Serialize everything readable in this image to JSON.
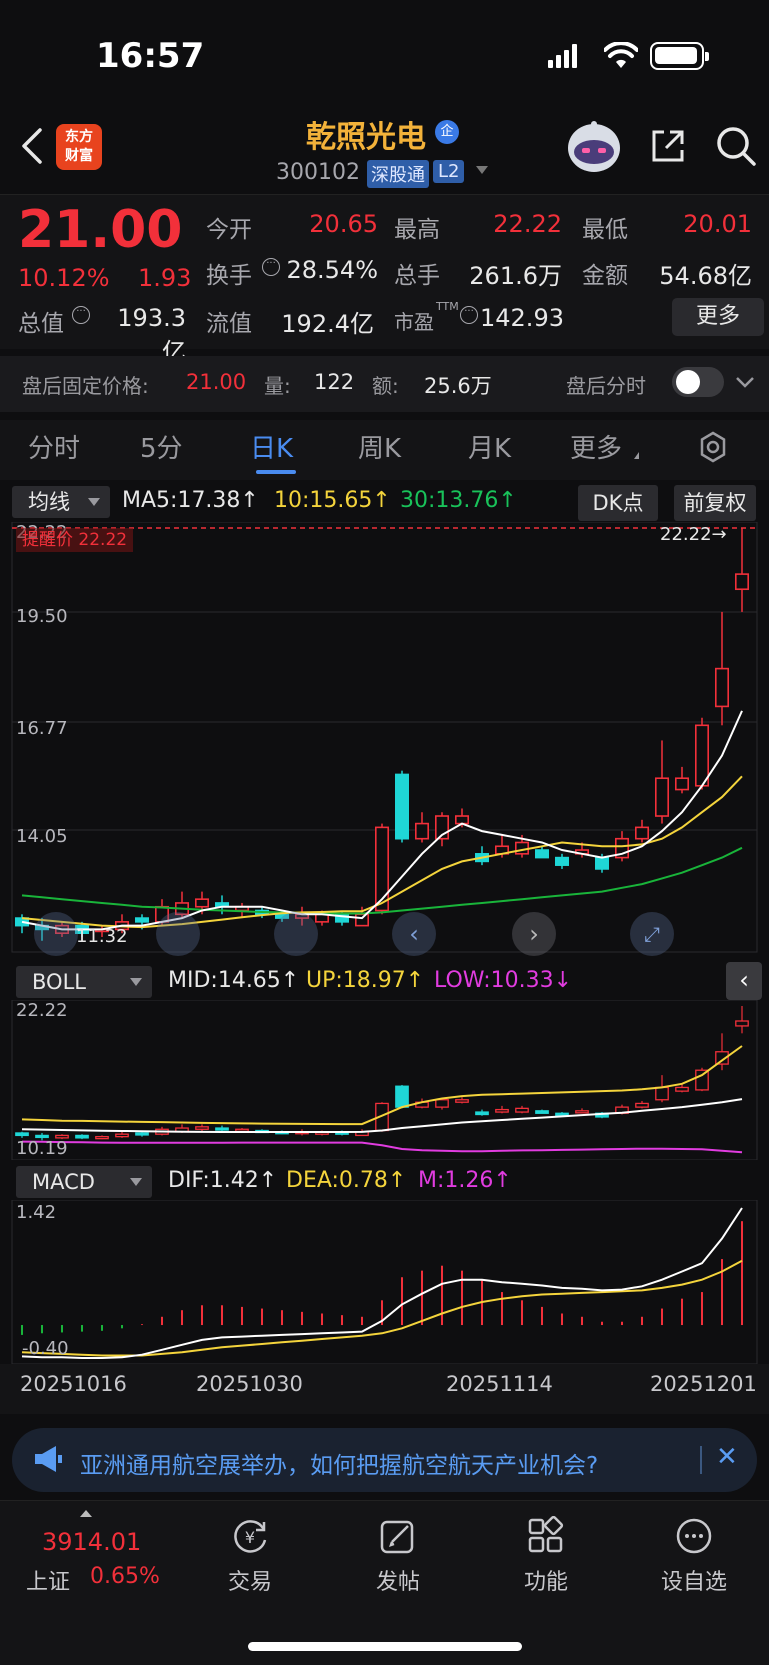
{
  "status": {
    "time": "16:57"
  },
  "header": {
    "logo_line1": "东方",
    "logo_line2": "财富",
    "stock_name": "乾照光电",
    "badge": "企",
    "code": "300102",
    "tag_sgt": "深股通",
    "tag_l2": "L2"
  },
  "quote": {
    "price": "21.00",
    "pct": "10.12%",
    "change": "1.93",
    "open_label": "今开",
    "open": "20.65",
    "high_label": "最高",
    "high": "22.22",
    "low_label": "最低",
    "low": "20.01",
    "turnover_label": "换手",
    "turnover": "28.54%",
    "volume_label": "总手",
    "volume": "261.6万",
    "amount_label": "金额",
    "amount": "54.68亿",
    "mcap_label": "总值",
    "mcap": "193.3亿",
    "float_label": "流值",
    "float": "192.4亿",
    "pe_label": "市盈",
    "pe_sup": "TTM",
    "pe": "142.93",
    "more": "更多"
  },
  "after_hours": {
    "label": "盘后固定价格:",
    "price": "21.00",
    "vol_label": "量:",
    "vol": "122",
    "amt_label": "额:",
    "amt": "25.6万",
    "toggle_label": "盘后分时"
  },
  "tabs": [
    "分时",
    "5分",
    "日K",
    "周K",
    "月K",
    "更多"
  ],
  "main_ind": {
    "selector": "均线",
    "ma5": "MA5:17.38↑",
    "ma10": "10:15.65↑",
    "ma30": "30:13.76↑",
    "dk": "DK点",
    "fq": "前复权",
    "alert": "提醒价 22.22",
    "max_marker": "22.22→",
    "min_marker": "11.32",
    "y_labels": [
      "22.22",
      "19.50",
      "16.77",
      "14.05",
      "11.32"
    ]
  },
  "boll": {
    "selector": "BOLL",
    "mid": "MID:14.65↑",
    "up": "UP:18.97↑",
    "low": "LOW:10.33↓",
    "y_top": "22.22",
    "y_bottom": "10.19"
  },
  "macd": {
    "selector": "MACD",
    "dif": "DIF:1.42↑",
    "dea": "DEA:0.78↑",
    "m": "M:1.26↑",
    "y_top": "1.42",
    "y_bottom": "-0.40"
  },
  "x_dates": [
    "20251016",
    "20251030",
    "20251114",
    "20251201"
  ],
  "ad": {
    "text": "亚洲通用航空展举办，如何把握航空航天产业机会?"
  },
  "nav": {
    "index_value": "3914.01",
    "index_name": "上证",
    "index_pct": "0.65%",
    "trade": "交易",
    "post": "发帖",
    "features": "功能",
    "watchlist": "设自选"
  },
  "colors": {
    "up": "#f2303a",
    "down": "#1fd6d6",
    "ma5": "#ffffff",
    "ma10": "#f4d43c",
    "ma30": "#19b43a",
    "accent": "#4a8cf0"
  },
  "chart_data": {
    "type": "candlestick",
    "ylim": [
      11.32,
      22.22
    ],
    "candles": [
      {
        "o": 11.9,
        "c": 11.7,
        "h": 12.0,
        "l": 11.5
      },
      {
        "o": 11.7,
        "c": 11.6,
        "h": 11.9,
        "l": 11.3
      },
      {
        "o": 11.5,
        "c": 11.7,
        "h": 11.8,
        "l": 11.4
      },
      {
        "o": 11.7,
        "c": 11.5,
        "h": 11.8,
        "l": 11.4
      },
      {
        "o": 11.6,
        "c": 11.6,
        "h": 11.7,
        "l": 11.4
      },
      {
        "o": 11.6,
        "c": 11.8,
        "h": 12.0,
        "l": 11.5
      },
      {
        "o": 11.9,
        "c": 11.8,
        "h": 12.0,
        "l": 11.6
      },
      {
        "o": 11.8,
        "c": 12.2,
        "h": 12.4,
        "l": 11.7
      },
      {
        "o": 12.0,
        "c": 12.3,
        "h": 12.6,
        "l": 11.9
      },
      {
        "o": 12.2,
        "c": 12.4,
        "h": 12.6,
        "l": 12.0
      },
      {
        "o": 12.3,
        "c": 12.2,
        "h": 12.5,
        "l": 12.0
      },
      {
        "o": 12.1,
        "c": 12.2,
        "h": 12.3,
        "l": 11.9
      },
      {
        "o": 12.1,
        "c": 12.0,
        "h": 12.2,
        "l": 11.9
      },
      {
        "o": 12.0,
        "c": 11.9,
        "h": 12.1,
        "l": 11.8
      },
      {
        "o": 11.9,
        "c": 12.0,
        "h": 12.2,
        "l": 11.7
      },
      {
        "o": 11.8,
        "c": 12.0,
        "h": 12.1,
        "l": 11.7
      },
      {
        "o": 12.0,
        "c": 11.8,
        "h": 12.1,
        "l": 11.7
      },
      {
        "o": 11.7,
        "c": 12.0,
        "h": 12.2,
        "l": 11.7
      },
      {
        "o": 12.1,
        "c": 14.3,
        "h": 14.4,
        "l": 12.0
      },
      {
        "o": 15.7,
        "c": 14.0,
        "h": 15.8,
        "l": 13.9
      },
      {
        "o": 14.0,
        "c": 14.4,
        "h": 14.7,
        "l": 13.9
      },
      {
        "o": 14.0,
        "c": 14.6,
        "h": 14.7,
        "l": 13.8
      },
      {
        "o": 14.4,
        "c": 14.6,
        "h": 14.8,
        "l": 14.3
      },
      {
        "o": 13.6,
        "c": 13.4,
        "h": 13.8,
        "l": 13.3
      },
      {
        "o": 13.6,
        "c": 13.8,
        "h": 14.1,
        "l": 13.5
      },
      {
        "o": 13.6,
        "c": 13.9,
        "h": 14.1,
        "l": 13.5
      },
      {
        "o": 13.7,
        "c": 13.5,
        "h": 13.8,
        "l": 13.5
      },
      {
        "o": 13.5,
        "c": 13.3,
        "h": 13.6,
        "l": 13.2
      },
      {
        "o": 13.6,
        "c": 13.7,
        "h": 13.9,
        "l": 13.5
      },
      {
        "o": 13.5,
        "c": 13.2,
        "h": 13.6,
        "l": 13.1
      },
      {
        "o": 13.5,
        "c": 14.0,
        "h": 14.2,
        "l": 13.4
      },
      {
        "o": 14.0,
        "c": 14.3,
        "h": 14.5,
        "l": 13.9
      },
      {
        "o": 14.6,
        "c": 15.6,
        "h": 16.6,
        "l": 14.4
      },
      {
        "o": 15.3,
        "c": 15.6,
        "h": 15.9,
        "l": 15.2
      },
      {
        "o": 15.4,
        "c": 17.0,
        "h": 17.2,
        "l": 15.3
      },
      {
        "o": 17.5,
        "c": 18.5,
        "h": 20.0,
        "l": 17.0
      },
      {
        "o": 20.6,
        "c": 21.0,
        "h": 22.22,
        "l": 20.0
      }
    ],
    "ma5": [
      11.8,
      11.7,
      11.6,
      11.6,
      11.6,
      11.7,
      11.7,
      11.8,
      11.9,
      12.1,
      12.2,
      12.2,
      12.2,
      12.1,
      12.0,
      12.0,
      11.95,
      11.9,
      12.4,
      13.0,
      13.6,
      14.1,
      14.4,
      14.2,
      14.1,
      14.0,
      13.9,
      13.7,
      13.6,
      13.5,
      13.6,
      13.8,
      14.2,
      14.7,
      15.4,
      16.2,
      17.38
    ],
    "ma10": [
      11.9,
      11.85,
      11.8,
      11.75,
      11.7,
      11.68,
      11.66,
      11.7,
      11.74,
      11.8,
      11.86,
      11.92,
      11.98,
      12.03,
      12.05,
      12.06,
      12.08,
      12.08,
      12.3,
      12.6,
      12.9,
      13.2,
      13.4,
      13.5,
      13.6,
      13.7,
      13.8,
      13.9,
      13.85,
      13.8,
      13.8,
      13.85,
      14.0,
      14.3,
      14.7,
      15.1,
      15.65
    ],
    "ma30": [
      12.5,
      12.45,
      12.4,
      12.35,
      12.3,
      12.25,
      12.2,
      12.18,
      12.15,
      12.12,
      12.1,
      12.08,
      12.06,
      12.05,
      12.04,
      12.03,
      12.02,
      12.02,
      12.05,
      12.1,
      12.15,
      12.2,
      12.25,
      12.3,
      12.35,
      12.4,
      12.45,
      12.5,
      12.55,
      12.6,
      12.7,
      12.8,
      12.95,
      13.1,
      13.3,
      13.5,
      13.76
    ],
    "boll_up": [
      13.0,
      12.95,
      12.9,
      12.88,
      12.85,
      12.82,
      12.8,
      12.78,
      12.75,
      12.72,
      12.7,
      12.68,
      12.66,
      12.65,
      12.64,
      12.63,
      12.62,
      12.62,
      13.3,
      14.0,
      14.4,
      14.7,
      14.9,
      15.0,
      15.05,
      15.1,
      15.15,
      15.2,
      15.25,
      15.3,
      15.35,
      15.45,
      15.6,
      15.9,
      16.6,
      17.8,
      18.97
    ],
    "boll_mid": [
      12.2,
      12.17,
      12.14,
      12.11,
      12.08,
      12.06,
      12.04,
      12.02,
      12.0,
      11.99,
      11.98,
      11.98,
      11.98,
      11.98,
      11.98,
      11.98,
      11.98,
      11.99,
      12.1,
      12.3,
      12.45,
      12.6,
      12.75,
      12.85,
      12.95,
      13.05,
      13.15,
      13.25,
      13.35,
      13.45,
      13.55,
      13.7,
      13.85,
      14.0,
      14.2,
      14.4,
      14.65
    ],
    "boll_low": [
      11.2,
      11.18,
      11.16,
      11.14,
      11.12,
      11.1,
      11.1,
      11.1,
      11.1,
      11.1,
      11.1,
      11.12,
      11.12,
      11.12,
      11.12,
      11.12,
      11.12,
      11.12,
      10.9,
      10.6,
      10.5,
      10.45,
      10.42,
      10.42,
      10.45,
      10.48,
      10.5,
      10.52,
      10.55,
      10.58,
      10.6,
      10.62,
      10.62,
      10.6,
      10.58,
      10.45,
      10.33
    ],
    "boll_ylim": [
      10.19,
      22.22
    ],
    "macd_dif": [
      -0.38,
      -0.39,
      -0.39,
      -0.4,
      -0.4,
      -0.39,
      -0.36,
      -0.3,
      -0.24,
      -0.18,
      -0.15,
      -0.14,
      -0.13,
      -0.12,
      -0.11,
      -0.1,
      -0.09,
      -0.08,
      0.05,
      0.25,
      0.38,
      0.5,
      0.55,
      0.55,
      0.52,
      0.5,
      0.48,
      0.45,
      0.44,
      0.42,
      0.43,
      0.47,
      0.55,
      0.65,
      0.75,
      1.05,
      1.42
    ],
    "macd_dea": [
      -0.33,
      -0.34,
      -0.35,
      -0.36,
      -0.37,
      -0.37,
      -0.37,
      -0.35,
      -0.33,
      -0.3,
      -0.27,
      -0.25,
      -0.23,
      -0.21,
      -0.19,
      -0.17,
      -0.15,
      -0.13,
      -0.1,
      -0.04,
      0.05,
      0.14,
      0.22,
      0.28,
      0.32,
      0.35,
      0.37,
      0.38,
      0.39,
      0.4,
      0.41,
      0.42,
      0.45,
      0.49,
      0.55,
      0.65,
      0.78
    ],
    "macd_m": [
      -0.12,
      -0.1,
      -0.09,
      -0.08,
      -0.07,
      -0.04,
      0.01,
      0.1,
      0.18,
      0.24,
      0.24,
      0.22,
      0.2,
      0.18,
      0.16,
      0.14,
      0.12,
      0.1,
      0.3,
      0.58,
      0.66,
      0.72,
      0.66,
      0.54,
      0.4,
      0.3,
      0.22,
      0.14,
      0.1,
      0.04,
      0.04,
      0.1,
      0.2,
      0.32,
      0.4,
      0.8,
      1.26
    ],
    "macd_ylim": [
      -0.4,
      1.42
    ]
  }
}
